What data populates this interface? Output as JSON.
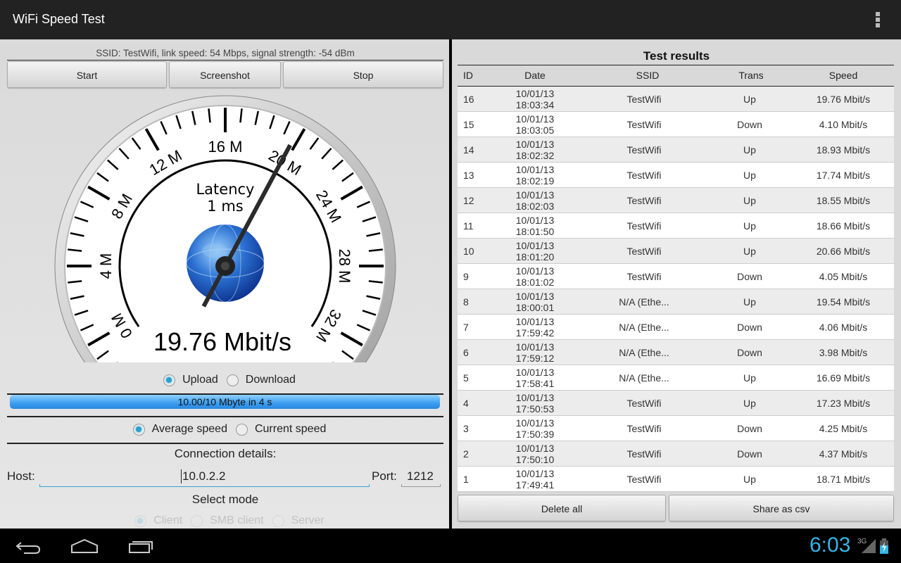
{
  "app": {
    "title": "WiFi Speed Test",
    "menu_icon": "overflow-menu-icon"
  },
  "status": {
    "ssid_line": "SSID: TestWifi, link speed: 54 Mbps, signal strength: -54 dBm"
  },
  "buttons": {
    "start": "Start",
    "screenshot": "Screenshot",
    "stop": "Stop",
    "delete_all": "Delete all",
    "share_csv": "Share as csv"
  },
  "gauge": {
    "min": 0,
    "max": 32,
    "value": 19.76,
    "unit": "Mbit/s",
    "value_text": "19.76 Mbit/s",
    "latency_label": "Latency",
    "latency_value": "1 ms",
    "tick_labels": [
      "0 M",
      "4 M",
      "8 M",
      "12 M",
      "16 M",
      "20 M",
      "24 M",
      "28 M",
      "32 M"
    ],
    "center_icon": "globe-icon"
  },
  "direction": {
    "upload": "Upload",
    "download": "Download",
    "selected": "Upload"
  },
  "progress": {
    "text": "10.00/10 Mbyte in 4 s",
    "fraction": 1.0,
    "color": "#3b9ef0"
  },
  "speed_mode": {
    "average": "Average speed",
    "current": "Current speed",
    "selected": "Average speed"
  },
  "connection": {
    "heading": "Connection details:",
    "host_label": "Host:",
    "host_value": "10.0.2.2",
    "port_label": "Port:",
    "port_value": "1212"
  },
  "mode": {
    "heading": "Select mode",
    "options": [
      "Client",
      "SMB client",
      "Server"
    ],
    "selected": "Client"
  },
  "results": {
    "title": "Test results",
    "headers": [
      "ID",
      "Date",
      "SSID",
      "Trans",
      "Speed"
    ],
    "rows": [
      [
        "16",
        "10/01/13",
        "18:03:34",
        "TestWifi",
        "Up",
        "19.76 Mbit/s"
      ],
      [
        "15",
        "10/01/13",
        "18:03:05",
        "TestWifi",
        "Down",
        "4.10 Mbit/s"
      ],
      [
        "14",
        "10/01/13",
        "18:02:32",
        "TestWifi",
        "Up",
        "18.93 Mbit/s"
      ],
      [
        "13",
        "10/01/13",
        "18:02:19",
        "TestWifi",
        "Up",
        "17.74 Mbit/s"
      ],
      [
        "12",
        "10/01/13",
        "18:02:03",
        "TestWifi",
        "Up",
        "18.55 Mbit/s"
      ],
      [
        "11",
        "10/01/13",
        "18:01:50",
        "TestWifi",
        "Up",
        "18.66 Mbit/s"
      ],
      [
        "10",
        "10/01/13",
        "18:01:20",
        "TestWifi",
        "Up",
        "20.66 Mbit/s"
      ],
      [
        "9",
        "10/01/13",
        "18:01:02",
        "TestWifi",
        "Down",
        "4.05 Mbit/s"
      ],
      [
        "8",
        "10/01/13",
        "18:00:01",
        "N/A (Ethe...",
        "Up",
        "19.54 Mbit/s"
      ],
      [
        "7",
        "10/01/13",
        "17:59:42",
        "N/A (Ethe...",
        "Down",
        "4.06 Mbit/s"
      ],
      [
        "6",
        "10/01/13",
        "17:59:12",
        "N/A (Ethe...",
        "Down",
        "3.98 Mbit/s"
      ],
      [
        "5",
        "10/01/13",
        "17:58:41",
        "N/A (Ethe...",
        "Up",
        "16.69 Mbit/s"
      ],
      [
        "4",
        "10/01/13",
        "17:50:53",
        "TestWifi",
        "Up",
        "17.23 Mbit/s"
      ],
      [
        "3",
        "10/01/13",
        "17:50:39",
        "TestWifi",
        "Down",
        "4.25 Mbit/s"
      ],
      [
        "2",
        "10/01/13",
        "17:50:10",
        "TestWifi",
        "Down",
        "4.37 Mbit/s"
      ],
      [
        "1",
        "10/01/13",
        "17:49:41",
        "TestWifi",
        "Up",
        "18.71 Mbit/s"
      ]
    ]
  },
  "system": {
    "time": "6:03",
    "network": "3G",
    "accent": "#33b5e5"
  }
}
